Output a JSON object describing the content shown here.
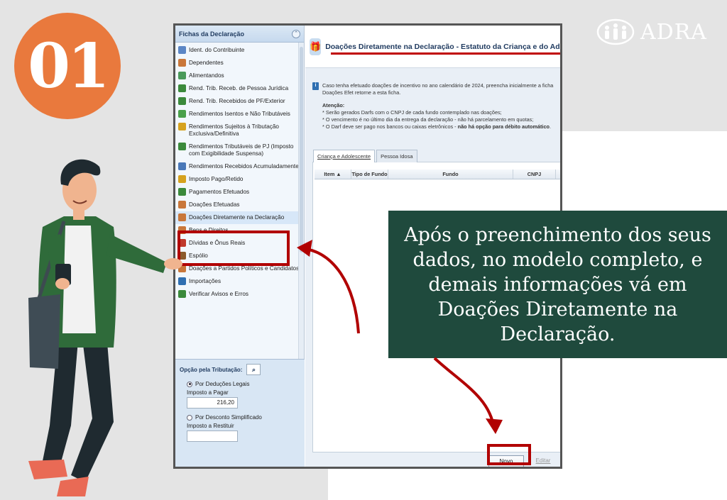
{
  "step_number": "01",
  "brand": {
    "name": "ADRA"
  },
  "sidebar": {
    "header": "Fichas da Declaração",
    "items": [
      {
        "label": "Ident. do Contribuinte",
        "icon": "person-icon",
        "color": "#5b86c5"
      },
      {
        "label": "Dependentes",
        "icon": "people-icon",
        "color": "#c9773a"
      },
      {
        "label": "Alimentandos",
        "icon": "people-icon",
        "color": "#4a9a5a"
      },
      {
        "label": "Rend. Trib. Receb. de Pessoa Jurídica",
        "icon": "money-icon",
        "color": "#3b8a3b"
      },
      {
        "label": "Rend. Trib. Recebidos de PF/Exterior",
        "icon": "money-icon",
        "color": "#3b8a3b"
      },
      {
        "label": "Rendimentos Isentos e Não Tributáveis",
        "icon": "check-icon",
        "color": "#4aa04a"
      },
      {
        "label": "Rendimentos Sujeitos à Tributação Exclusiva/Definitiva",
        "icon": "warning-icon",
        "color": "#d6a21e"
      },
      {
        "label": "Rendimentos Tributáveis de PJ (Imposto com Exigibilidade Suspensa)",
        "icon": "money-icon",
        "color": "#3b8a3b"
      },
      {
        "label": "Rendimentos Recebidos Acumuladamente",
        "icon": "clock-icon",
        "color": "#4a78b8"
      },
      {
        "label": "Imposto Pago/Retido",
        "icon": "coin-icon",
        "color": "#d6a21e"
      },
      {
        "label": "Pagamentos Efetuados",
        "icon": "card-icon",
        "color": "#3b8a3b"
      },
      {
        "label": "Doações Efetuadas",
        "icon": "gift-icon",
        "color": "#c9773a"
      },
      {
        "label": "Doações Diretamente na Declaração",
        "icon": "gift-icon",
        "color": "#c9773a"
      },
      {
        "label": "Bens e Direitos",
        "icon": "house-icon",
        "color": "#c9773a"
      },
      {
        "label": "Dívidas e Ônus Reais",
        "icon": "arrow-down-icon",
        "color": "#c0392b"
      },
      {
        "label": "Espólio",
        "icon": "chest-icon",
        "color": "#8b5a2b"
      },
      {
        "label": "Doações a Partidos Políticos e Candidatos",
        "icon": "people-icon",
        "color": "#c9773a"
      },
      {
        "label": "Importações",
        "icon": "import-icon",
        "color": "#2f6fb1"
      },
      {
        "label": "Verificar Avisos e Erros",
        "icon": "check-icon",
        "color": "#3b8a3b"
      }
    ]
  },
  "tax_option": {
    "title": "Opção pela Tributação:",
    "legal_deductions": "Por Deduções Legais",
    "tax_due_label": "Imposto a Pagar",
    "tax_due_value": "216,20",
    "simplified": "Por Desconto Simplificado",
    "refund_label": "Imposto a Restituir",
    "refund_value": ""
  },
  "content": {
    "title": "Doações Diretamente na Declaração - Estatuto da Criança e do Adolescente (",
    "info_text": "Caso tenha efetuado doações de incentivo no ano calendário de 2024, preencha inicialmente a ficha Doações Efet retorne a esta ficha.",
    "attention_title": "Atenção:",
    "attention_1": "* Serão gerados Darfs com o CNPJ de cada fundo contemplado nas doações;",
    "attention_2": "* O vencimento é no último dia da entrega da declaração - não há parcelamento em quotas;",
    "attention_3_prefix": "* O Darf deve ser pago nos bancos ou caixas eletrônicos - ",
    "attention_3_bold": "não há opção para débito automático",
    "attention_3_suffix": ".",
    "tabs": [
      "Criança e Adolescente",
      "Pessoa Idosa"
    ],
    "columns": [
      "Item ▲",
      "Tipo de Fundo",
      "Fundo",
      "CNPJ"
    ],
    "buttons": {
      "new": "Novo",
      "edit": "Editar"
    }
  },
  "callout": {
    "text": "Após o preenchimento dos seus dados, no modelo completo, e demais informações vá em Doações Diretamente na Declaração."
  },
  "colors": {
    "badge": "#e9793d",
    "callout_bg": "#1f4a3d",
    "highlight": "#b10000",
    "panel": "#f2f7fc"
  }
}
